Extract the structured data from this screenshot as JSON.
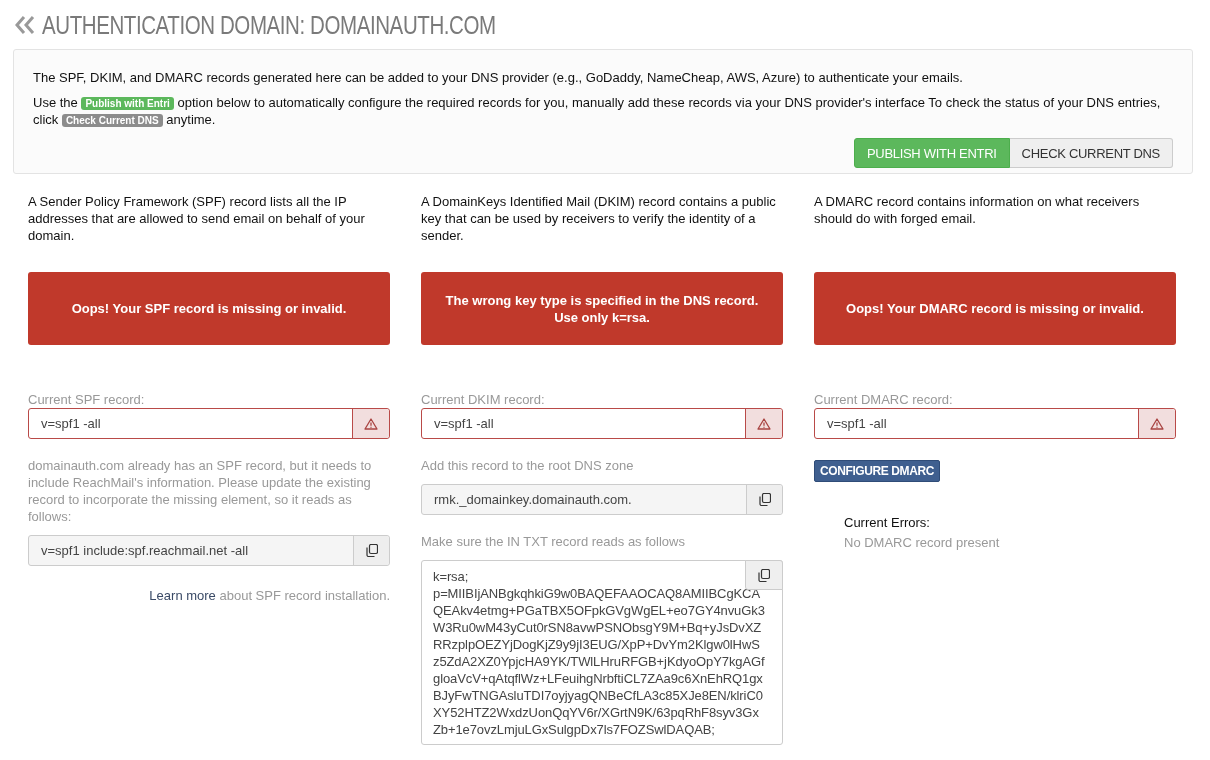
{
  "header": {
    "title": "AUTHENTICATION DOMAIN: DOMAINAUTH.COM"
  },
  "intro": {
    "paragraphs": [
      [
        {
          "kind": "text",
          "text": "The SPF, DKIM, and DMARC records generated here can be added to your DNS provider (e.g., GoDaddy, NameCheap, AWS, Azure) to authenticate your emails."
        }
      ],
      [
        {
          "kind": "text",
          "text": "Use the "
        },
        {
          "kind": "badge",
          "text": "Publish with Entri",
          "color": "#5cb85c"
        },
        {
          "kind": "text",
          "text": " option below to automatically configure the required records for you, manually add these records via your DNS provider's interface To check the status of your DNS entries, click "
        },
        {
          "kind": "badge",
          "text": "Check Current DNS",
          "color": "#8c8c8c"
        },
        {
          "kind": "text",
          "text": " anytime."
        }
      ]
    ],
    "buttons": [
      {
        "label": "PUBLISH WITH ENTRI",
        "kind": "primary"
      },
      {
        "label": "CHECK CURRENT DNS",
        "kind": "default"
      }
    ]
  },
  "columns": [
    {
      "description": "A Sender Policy Framework (SPF) record lists all the IP addresses that are allowed to send email on behalf of your domain.",
      "alert": "Oops! Your SPF record is missing or invalid.",
      "current_label": "Current SPF record:",
      "current_value": "v=spf1 -all",
      "invalid": true,
      "items": [
        {
          "kind": "hint",
          "text": "domainauth.com already has an SPF record, but it needs to include ReachMail's information. Please update the existing record to incorporate the missing element, so it reads as follows:"
        },
        {
          "kind": "field",
          "value": "v=spf1 include:spf.reachmail.net -all"
        },
        {
          "kind": "link_line",
          "link": "Learn more",
          "text": " about SPF record installation."
        }
      ]
    },
    {
      "description": "A DomainKeys Identified Mail (DKIM) record contains a public key that can be used by receivers to verify the identity of a sender.",
      "alert": "The wrong key type is specified in the DNS record. Use only k=rsa.",
      "current_label": "Current DKIM record:",
      "current_value": "v=spf1 -all",
      "invalid": true,
      "items": [
        {
          "kind": "hint",
          "text": "Add this record to the root DNS zone"
        },
        {
          "kind": "field",
          "value": "rmk._domainkey.domainauth.com."
        },
        {
          "kind": "hint",
          "text": "Make sure the IN TXT record reads as follows"
        },
        {
          "kind": "textarea",
          "value": "k=rsa;\np=MIIBIjANBgkqhkiG9w0BAQEFAAOCAQ8AMIIBCgKCA\nQEAkv4etmg+PGaTBX5OFpkGVgWgEL+eo7GY4nvuGk3\nW3Ru0wM43yCut0rSN8avwPSNObsgY9M+Bq+yJsDvXZ\nRRzplpOEZYjDogKjZ9y9jI3EUG/XpP+DvYm2Klgw0lHwS\nz5ZdA2XZ0YpjcHA9YK/TWlLHruRFGB+jKdyoOpY7kgAGf\ngloaVcV+qAtqflWz+LFeuihgNrbftiCL7ZAa9c6XnEhRQ1gx\nBJyFwTNGAsluTDI7oyjyagQNBeCfLA3c85XJe8EN/klriC0\nXY52HTZ2WxdzUonQqYV6r/XGrtN9K/63pqRhF8syv3Gx\nZb+1e7ovzLmjuLGxSulgpDx7ls7FOZSwlDAQAB;"
        }
      ]
    },
    {
      "description": "A DMARC record contains information on what receivers should do with forged email.",
      "alert": "Oops! Your DMARC record is missing or invalid.",
      "current_label": "Current DMARC record:",
      "current_value": "v=spf1 -all",
      "invalid": true,
      "items": [
        {
          "kind": "button",
          "label": "CONFIGURE DMARC"
        },
        {
          "kind": "errors",
          "title": "Current Errors:",
          "text": "No DMARC record present"
        }
      ]
    }
  ]
}
